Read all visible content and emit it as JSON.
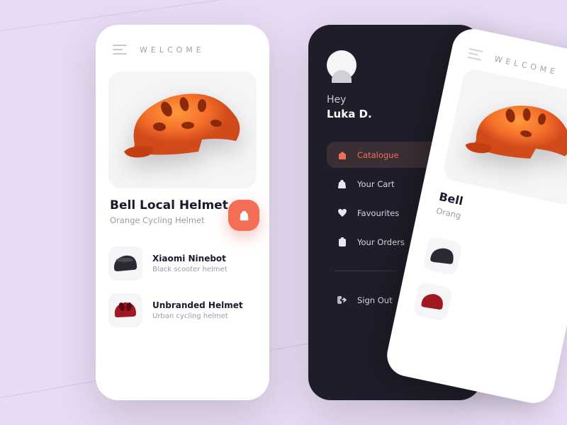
{
  "header": {
    "title": "WELCOME"
  },
  "hero": {
    "title": "Bell Local Helmet",
    "subtitle": "Orange Cycling Helmet"
  },
  "items": [
    {
      "title": "Xiaomi Ninebot",
      "subtitle": "Black scooter helmet"
    },
    {
      "title": "Unbranded Helmet",
      "subtitle": "Urban cycling helmet"
    }
  ],
  "drawer": {
    "greeting": "Hey",
    "user": "Luka D.",
    "nav": [
      {
        "label": "Catalogue",
        "icon": "home"
      },
      {
        "label": "Your Cart",
        "icon": "bag"
      },
      {
        "label": "Favourites",
        "icon": "heart"
      },
      {
        "label": "Your Orders",
        "icon": "clipboard"
      }
    ],
    "signout": "Sign Out"
  }
}
